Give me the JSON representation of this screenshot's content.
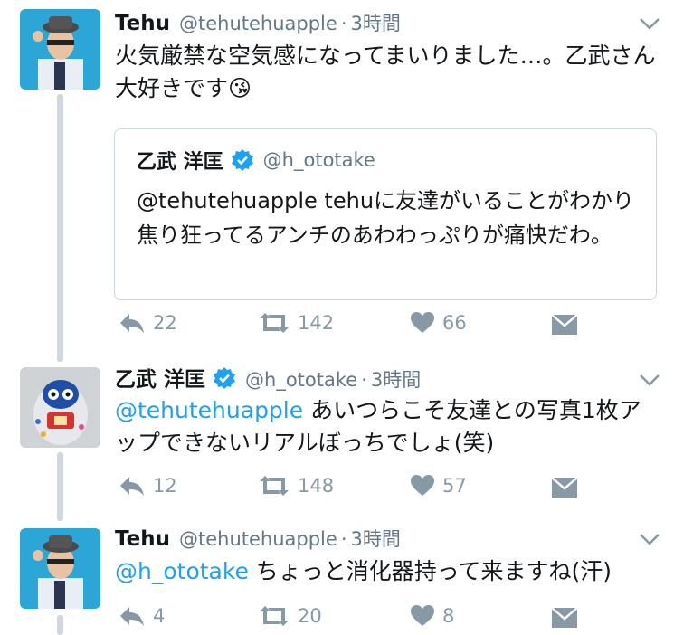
{
  "tweets": [
    {
      "name": "Tehu",
      "handle": "@tehutehuapple",
      "dot": "·",
      "time": "3時間",
      "text": "火気厳禁な空気感になってまいりました…。乙武さん大好きです😘",
      "quote": {
        "name": "乙武 洋匡",
        "handle": "@h_ototake",
        "text": "@tehutehuapple tehuに友達がいることがわかり焦り狂ってるアンチのあわわっぷりが痛快だわ。"
      },
      "replies": "22",
      "retweets": "142",
      "likes": "66"
    },
    {
      "name": "乙武 洋匡",
      "handle": "@h_ototake",
      "dot": "·",
      "time": "3時間",
      "mention": "@tehutehuapple",
      "text": " あいつらこそ友達との写真1枚アップできないリアルぼっちでしょ(笑)",
      "replies": "12",
      "retweets": "148",
      "likes": "57"
    },
    {
      "name": "Tehu",
      "handle": "@tehutehuapple",
      "dot": "·",
      "time": "3時間",
      "mention": "@h_ototake",
      "text": " ちょっと消化器持って来ますね(汗)",
      "replies": "4",
      "retweets": "20",
      "likes": "8"
    }
  ],
  "icons": [
    "chevron-down-icon",
    "verified-icon",
    "reply-icon",
    "retweet-icon",
    "like-icon",
    "dm-icon"
  ],
  "colors": {
    "link": "#1da1f2",
    "meta": "#657786",
    "icon": "#8899a6",
    "verified": "#1da1f2",
    "thread": "#d0d7de"
  }
}
